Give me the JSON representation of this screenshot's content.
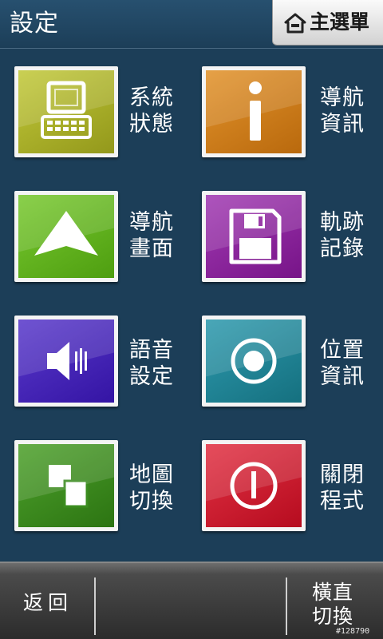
{
  "header": {
    "title": "設定",
    "main_menu_label": "主選單"
  },
  "tiles": [
    {
      "name": "system-status",
      "icon": "computer-icon",
      "line1": "系統",
      "line2": "狀態",
      "color": "#a9b023"
    },
    {
      "name": "navigation-info",
      "icon": "info-icon",
      "line1": "導航",
      "line2": "資訊",
      "color": "#cd7c16"
    },
    {
      "name": "navigation-screen",
      "icon": "arrow-up-icon",
      "line1": "導航",
      "line2": "畫面",
      "color": "#5fb21c"
    },
    {
      "name": "track-record",
      "icon": "floppy-disk-icon",
      "line1": "軌跡",
      "line2": "記錄",
      "color": "#8b1f9b"
    },
    {
      "name": "voice-settings",
      "icon": "speaker-icon",
      "line1": "語音",
      "line2": "設定",
      "color": "#4420b6"
    },
    {
      "name": "location-info",
      "icon": "target-icon",
      "line1": "位置",
      "line2": "資訊",
      "color": "#1f8598"
    },
    {
      "name": "map-switch",
      "icon": "squares-icon",
      "line1": "地圖",
      "line2": "切換",
      "color": "#3b8c1f"
    },
    {
      "name": "close-program",
      "icon": "power-icon",
      "line1": "關閉",
      "line2": "程式",
      "color": "#d2182b"
    }
  ],
  "bottom": {
    "back_label": "返回",
    "rotate_line1": "橫直",
    "rotate_line2": "切換"
  },
  "watermark": "#128790"
}
